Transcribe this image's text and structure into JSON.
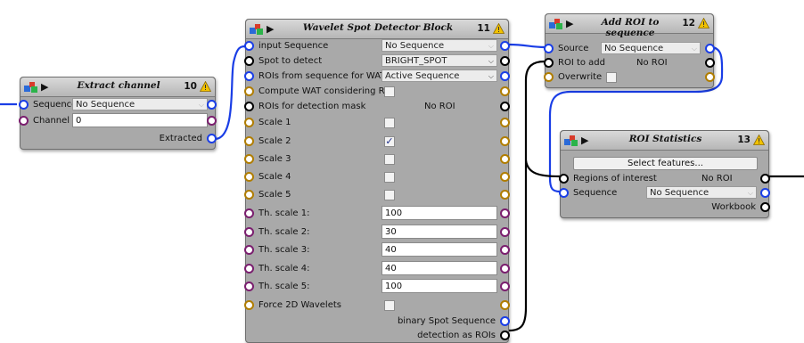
{
  "blocks": {
    "extract_channel": {
      "title": "Extract channel",
      "number": "10",
      "sequence_label": "Sequence",
      "sequence_value": "No Sequence",
      "channel_label": "Channel",
      "channel_value": "0",
      "extracted_label": "Extracted"
    },
    "wavelet": {
      "title": "Wavelet Spot Detector Block",
      "number": "11",
      "input_sequence_label": "input Sequence",
      "input_sequence_value": "No Sequence",
      "spot_label": "Spot to detect",
      "spot_value": "BRIGHT_SPOT",
      "rois_wat_label": "ROIs from sequence for WAT",
      "rois_wat_value": "Active Sequence",
      "compute_wat_label": "Compute WAT considering ROI",
      "compute_wat_checked": false,
      "rois_mask_label": "ROIs for detection mask",
      "rois_mask_value": "No ROI",
      "scales": [
        {
          "label": "Scale 1",
          "checked": false
        },
        {
          "label": "Scale 2",
          "checked": true
        },
        {
          "label": "Scale 3",
          "checked": false
        },
        {
          "label": "Scale 4",
          "checked": false
        },
        {
          "label": "Scale 5",
          "checked": false
        }
      ],
      "thresholds": [
        {
          "label": "Th. scale 1:",
          "value": "100"
        },
        {
          "label": "Th. scale 2:",
          "value": "30"
        },
        {
          "label": "Th. scale 3:",
          "value": "40"
        },
        {
          "label": "Th. scale 4:",
          "value": "40"
        },
        {
          "label": "Th. scale 5:",
          "value": "100"
        }
      ],
      "force2d_label": "Force 2D Wavelets",
      "force2d_checked": false,
      "binary_label": "binary Spot Sequence",
      "rois_out_label": "detection as ROIs"
    },
    "add_roi": {
      "title": "Add ROI to sequence",
      "number": "12",
      "source_label": "Source",
      "source_value": "No Sequence",
      "roi_label": "ROI to add",
      "roi_value": "No ROI",
      "overwrite_label": "Overwrite",
      "overwrite_checked": false
    },
    "roi_stats": {
      "title": "ROI Statistics",
      "number": "13",
      "select_button": "Select features...",
      "regions_label": "Regions of interest",
      "regions_value": "No ROI",
      "sequence_label": "Sequence",
      "sequence_value": "No Sequence",
      "workbook_label": "Workbook"
    }
  },
  "icons": {
    "run": "play-icon",
    "warning": "warning-icon",
    "logo": "blocks-logo-icon",
    "dropdown": "chevron-down-icon"
  },
  "colors": {
    "block_bg": "#a9a9a9",
    "link": "#1a3ee6",
    "port_sequence": "#1a3ee6",
    "port_roi": "#000000",
    "port_integer": "#7a1e6e",
    "port_boolean": "#b07d00"
  }
}
